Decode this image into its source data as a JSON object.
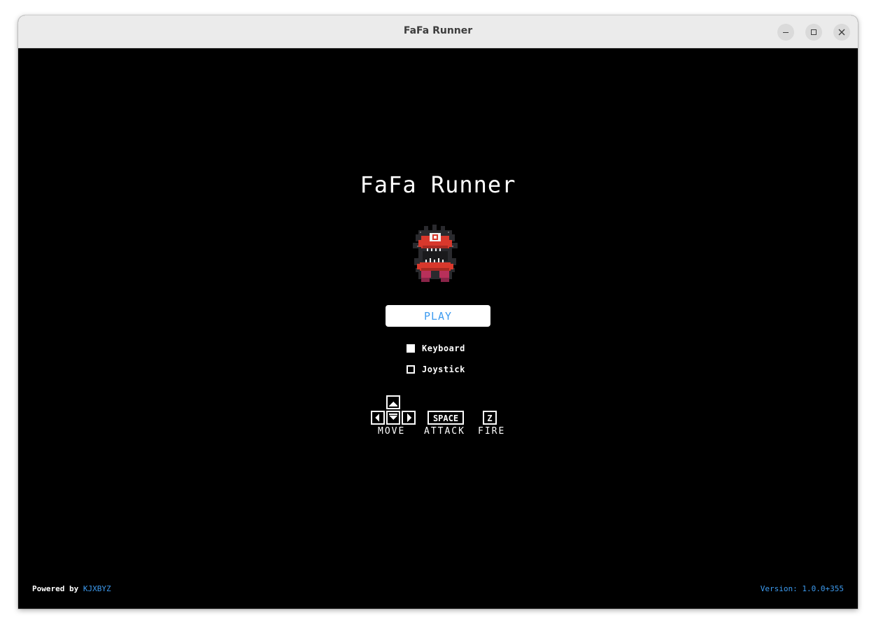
{
  "window": {
    "title": "FaFa Runner"
  },
  "game": {
    "title": "FaFa Runner",
    "play_label": "PLAY",
    "input_options": [
      {
        "label": "Keyboard",
        "checked": true
      },
      {
        "label": "Joystick",
        "checked": false
      }
    ],
    "controls": [
      {
        "keys": "arrow keys",
        "label": "MOVE"
      },
      {
        "keys": "SPACE",
        "label": "ATTACK"
      },
      {
        "keys": "Z",
        "label": "FIRE"
      }
    ]
  },
  "footer": {
    "powered_prefix": "Powered by ",
    "powered_brand": "KJXBYZ",
    "version": "Version: 1.0.0+355"
  },
  "colors": {
    "accent": "#3d9bf0",
    "background": "#000000",
    "titlebar": "#ebebeb"
  }
}
